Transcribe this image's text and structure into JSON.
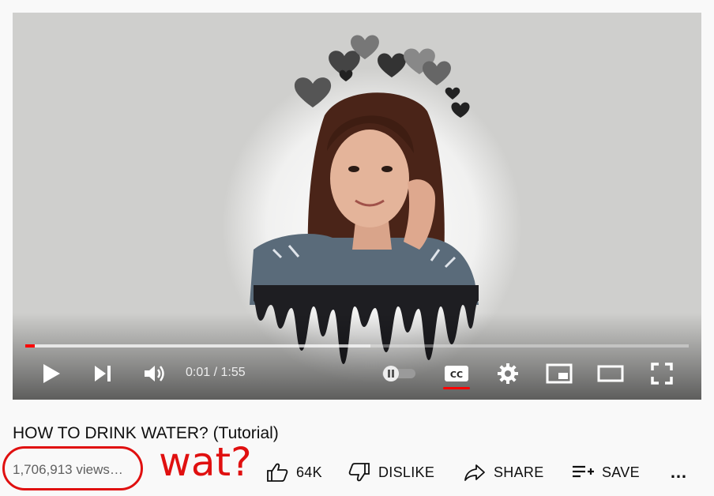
{
  "video": {
    "time_current": "0:01",
    "time_separator": "/",
    "time_total": "1:55",
    "progress_played": 0.014,
    "progress_buffered": 0.52
  },
  "info": {
    "title": "HOW TO DRINK WATER? (Tutorial)",
    "views": "1,706,913 views…"
  },
  "annotation": {
    "text": "wat?",
    "color": "#e01010"
  },
  "actions": {
    "like_count": "64K",
    "dislike_label": "DISLIKE",
    "share_label": "SHARE",
    "save_label": "SAVE",
    "more_label": "…"
  },
  "colors": {
    "accent": "#ff0000",
    "page_bg": "#f9f9f9"
  }
}
